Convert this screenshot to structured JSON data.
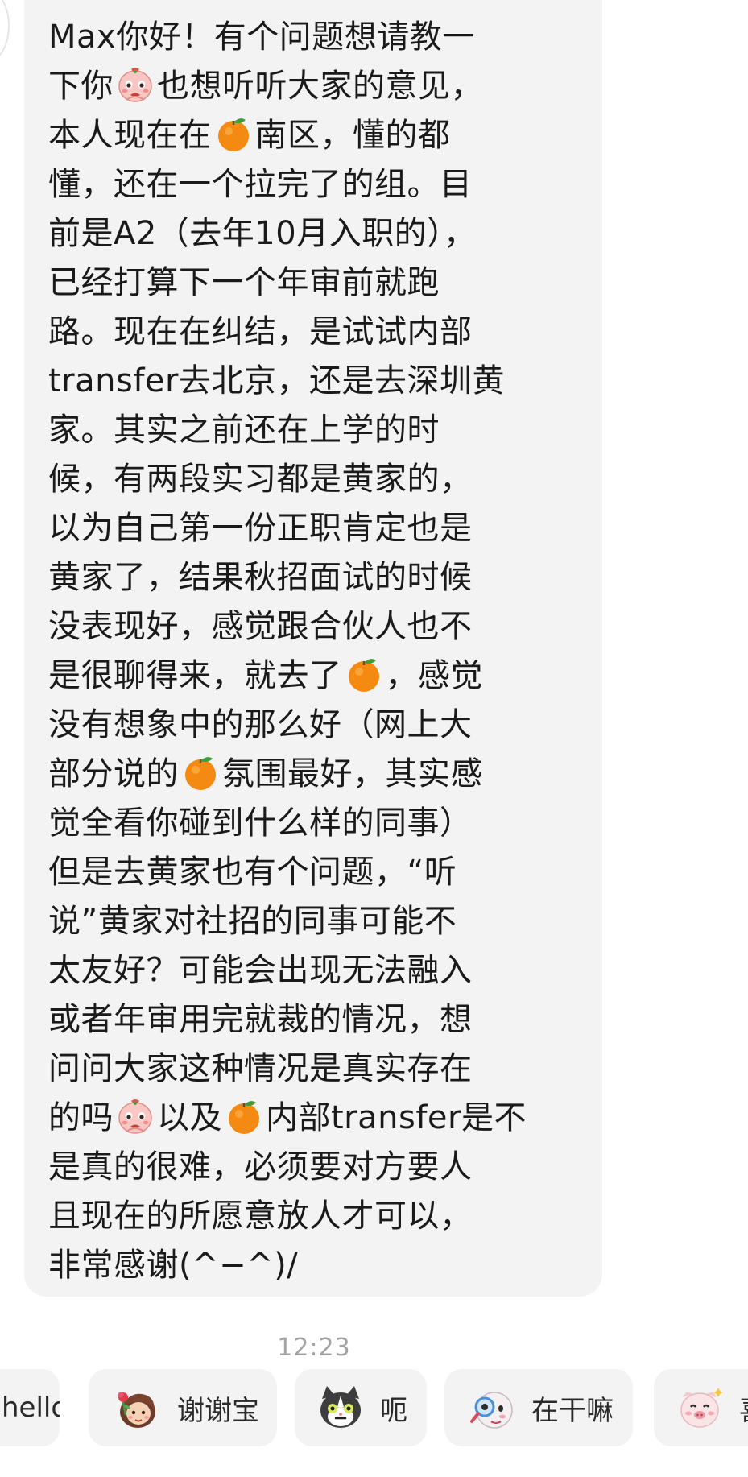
{
  "message": {
    "lines": [
      [
        {
          "t": "Max你好！有个问题想请教一"
        }
      ],
      [
        {
          "t": "下你"
        },
        {
          "e": "pink"
        },
        {
          "t": "也想听听大家的意见，"
        }
      ],
      [
        {
          "t": "本人现在在"
        },
        {
          "e": "orange"
        },
        {
          "t": "南区，懂的都"
        }
      ],
      [
        {
          "t": "懂，还在一个拉完了的组。目"
        }
      ],
      [
        {
          "t": "前是A2（去年10月入职的），"
        }
      ],
      [
        {
          "t": "已经打算下一个年审前就跑"
        }
      ],
      [
        {
          "t": "路。现在在纠结，是试试内部"
        }
      ],
      [
        {
          "t": "transfer去北京，还是去深圳黄"
        }
      ],
      [
        {
          "t": "家。其实之前还在上学的时"
        }
      ],
      [
        {
          "t": "候，有两段实习都是黄家的，"
        }
      ],
      [
        {
          "t": "以为自己第一份正职肯定也是"
        }
      ],
      [
        {
          "t": "黄家了，结果秋招面试的时候"
        }
      ],
      [
        {
          "t": "没表现好，感觉跟合伙人也不"
        }
      ],
      [
        {
          "t": "是很聊得来，就去了"
        },
        {
          "e": "orange"
        },
        {
          "t": "，感觉"
        }
      ],
      [
        {
          "t": "没有想象中的那么好（网上大"
        }
      ],
      [
        {
          "t": "部分说的"
        },
        {
          "e": "orange"
        },
        {
          "t": "氛围最好，其实感"
        }
      ],
      [
        {
          "t": "觉全看你碰到什么样的同事）"
        }
      ],
      [
        {
          "t": "但是去黄家也有个问题，“听"
        }
      ],
      [
        {
          "t": "说”黄家对社招的同事可能不"
        }
      ],
      [
        {
          "t": "太友好？可能会出现无法融入"
        }
      ],
      [
        {
          "t": "或者年审用完就裁的情况，想"
        }
      ],
      [
        {
          "t": "问问大家这种情况是真实存在"
        }
      ],
      [
        {
          "t": "的吗"
        },
        {
          "e": "pink"
        },
        {
          "t": "以及"
        },
        {
          "e": "orange"
        },
        {
          "t": "内部transfer是不"
        }
      ],
      [
        {
          "t": "是真的很难，必须要对方要人"
        }
      ],
      [
        {
          "t": "且现在的所愿意放人才可以，"
        }
      ],
      [
        {
          "t": "非常感谢(^−^)/"
        }
      ]
    ]
  },
  "timestamp": "12:23",
  "quick_replies": [
    {
      "label": "hello",
      "icon": ""
    },
    {
      "label": "谢谢宝",
      "icon": "girl-rose-sticker"
    },
    {
      "label": "呃",
      "icon": "cat-sticker"
    },
    {
      "label": "在干嘛",
      "icon": "magnifier-sticker"
    },
    {
      "label": "喜",
      "icon": "pig-sticker"
    }
  ],
  "colors": {
    "bubble": "#f3f3f3",
    "text": "#1a1a1a",
    "timestamp": "#a3a3a3",
    "orange": "#f58a12"
  }
}
